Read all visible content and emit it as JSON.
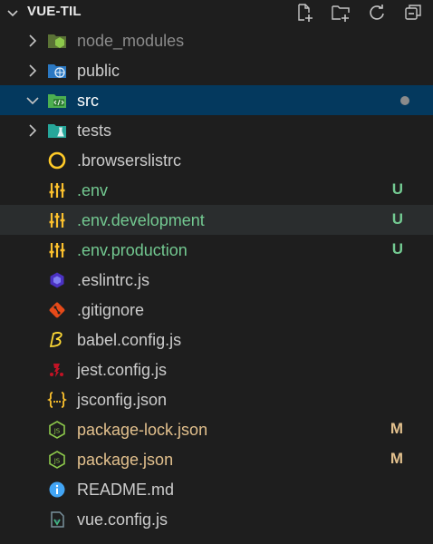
{
  "explorer": {
    "section_title": "VUE-TIL",
    "toolbar": [
      {
        "name": "new-file-icon"
      },
      {
        "name": "new-folder-icon"
      },
      {
        "name": "refresh-icon"
      },
      {
        "name": "collapse-all-icon"
      }
    ]
  },
  "tree": {
    "items": [
      {
        "label": "node_modules",
        "kind": "folder",
        "expanded": false,
        "icon": "folder-node-icon",
        "color": "#8b8b8b"
      },
      {
        "label": "public",
        "kind": "folder",
        "expanded": false,
        "icon": "folder-public-icon",
        "color": "#cccccc"
      },
      {
        "label": "src",
        "kind": "folder",
        "expanded": true,
        "icon": "folder-src-icon",
        "color": "#ffffff",
        "selected": true,
        "modified_dot": true
      },
      {
        "label": "tests",
        "kind": "folder",
        "expanded": false,
        "icon": "folder-tests-icon",
        "color": "#cccccc"
      },
      {
        "label": ".browserslistrc",
        "kind": "file",
        "icon": "browserslist-icon",
        "color": "#cccccc"
      },
      {
        "label": ".env",
        "kind": "file",
        "icon": "env-settings-icon",
        "color": "#73c991",
        "status": "U"
      },
      {
        "label": ".env.development",
        "kind": "file",
        "icon": "env-settings-icon",
        "color": "#73c991",
        "status": "U",
        "hover": true
      },
      {
        "label": ".env.production",
        "kind": "file",
        "icon": "env-settings-icon",
        "color": "#73c991",
        "status": "U"
      },
      {
        "label": ".eslintrc.js",
        "kind": "file",
        "icon": "eslint-icon",
        "color": "#cccccc"
      },
      {
        "label": ".gitignore",
        "kind": "file",
        "icon": "git-icon",
        "color": "#cccccc"
      },
      {
        "label": "babel.config.js",
        "kind": "file",
        "icon": "babel-icon",
        "color": "#cccccc"
      },
      {
        "label": "jest.config.js",
        "kind": "file",
        "icon": "jest-icon",
        "color": "#cccccc"
      },
      {
        "label": "jsconfig.json",
        "kind": "file",
        "icon": "json-braces-icon",
        "color": "#cccccc"
      },
      {
        "label": "package-lock.json",
        "kind": "file",
        "icon": "nodejs-icon",
        "color": "#e2c08d",
        "status": "M"
      },
      {
        "label": "package.json",
        "kind": "file",
        "icon": "nodejs-icon",
        "color": "#e2c08d",
        "status": "M"
      },
      {
        "label": "README.md",
        "kind": "file",
        "icon": "info-icon",
        "color": "#cccccc"
      },
      {
        "label": "vue.config.js",
        "kind": "file",
        "icon": "vue-config-icon",
        "color": "#cccccc"
      }
    ]
  }
}
